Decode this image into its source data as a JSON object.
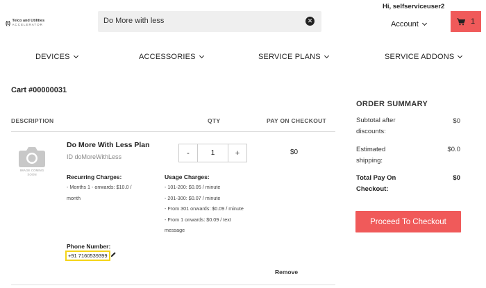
{
  "header": {
    "logo": {
      "mark": "(t)",
      "line1": "Telco and Utilities",
      "line2": "ACCELERATOR"
    },
    "search": {
      "value": "Do More with less",
      "clear_icon": "close-circle-icon"
    },
    "greeting": "Hi, selfserviceuser2",
    "account_label": "Account",
    "cart": {
      "icon": "cart-icon",
      "count": "1"
    }
  },
  "nav": {
    "items": [
      {
        "label": "DEVICES"
      },
      {
        "label": "ACCESSORIES"
      },
      {
        "label": "SERVICE PLANS"
      },
      {
        "label": "SERVICE ADDONS"
      }
    ]
  },
  "cart": {
    "title": "Cart #00000031",
    "columns": {
      "description": "DESCRIPTION",
      "qty": "QTY",
      "pay": "PAY ON CHECKOUT"
    },
    "item": {
      "image_placeholder": "IMAGE COMING SOON",
      "name": "Do More With Less Plan",
      "id_text": "ID doMoreWithLess",
      "qty_minus": "-",
      "qty_value": "1",
      "qty_plus": "+",
      "price": "$0",
      "recurring": {
        "title": "Recurring Charges:",
        "lines": [
          "- Months 1 - onwards: $10.0 /",
          "month"
        ]
      },
      "usage": {
        "title": "Usage Charges:",
        "lines": [
          "- 101-200: $0.05 / minute",
          "- 201-300: $0.07 / minute",
          "- From 301 onwards: $0.09 / minute",
          "- From 1 onwards: $0.09 / text",
          "message"
        ]
      },
      "phone_label": "Phone Number:",
      "phone_value": "+91 7160539399",
      "remove_label": "Remove"
    }
  },
  "summary": {
    "title": "ORDER SUMMARY",
    "rows": [
      {
        "label": "Subtotal after discounts:",
        "value": "$0"
      },
      {
        "label": "Estimated shipping:",
        "value": "$0.0"
      },
      {
        "label": "Total Pay On Checkout:",
        "value": "$0"
      }
    ],
    "checkout_label": "Proceed To Checkout"
  },
  "colors": {
    "accent": "#f05a5a",
    "highlight": "#f5d418",
    "search_bg": "#efefef"
  }
}
